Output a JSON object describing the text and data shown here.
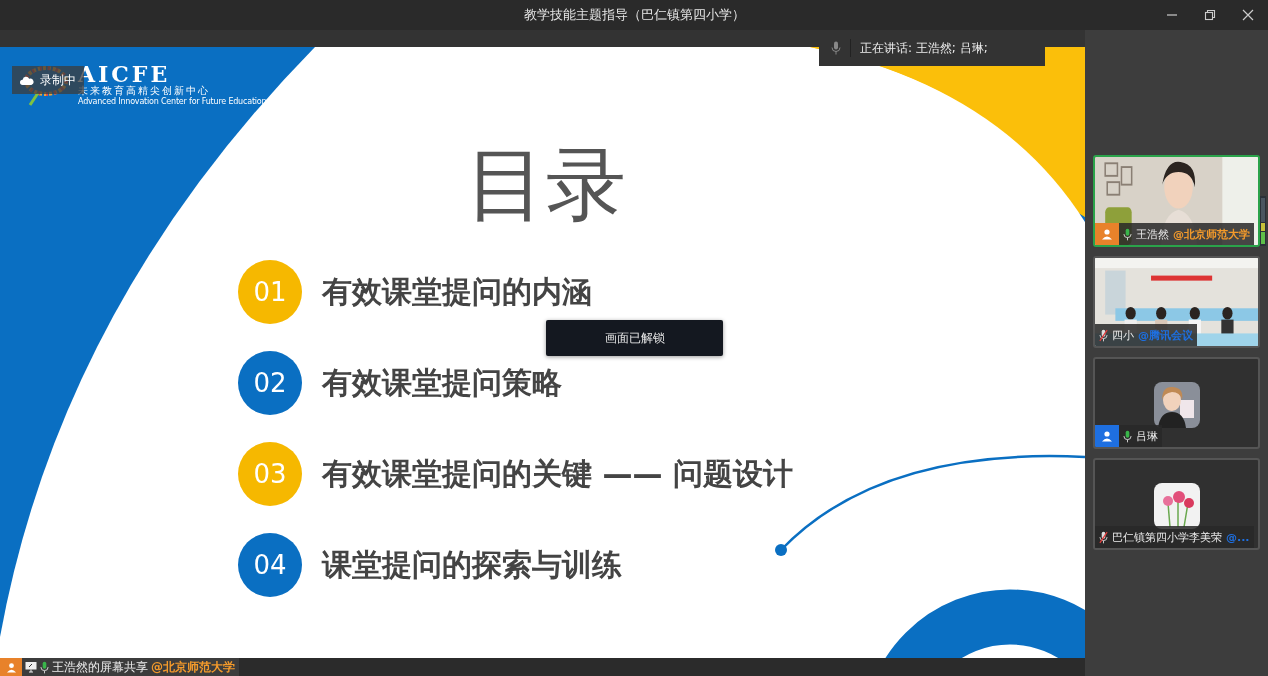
{
  "window": {
    "title": "教学技能主题指导（巴仁镇第四小学）"
  },
  "recording": {
    "label": "录制中"
  },
  "speaking": {
    "label": "正在讲话: 王浩然; 吕琳;"
  },
  "slide": {
    "logo": {
      "name": "AICFE",
      "subtitle": "未来教育高精尖创新中心",
      "english": "Advanced Innovation Center for Future Education"
    },
    "title": "目录",
    "items": [
      {
        "number": "01",
        "text": "有效课堂提问的内涵",
        "color": "#f6b800"
      },
      {
        "number": "02",
        "text": "有效课堂提问策略",
        "color": "#0a6fc2"
      },
      {
        "number": "03",
        "text": "有效课堂提问的关键 —— 问题设计",
        "color": "#f6b800"
      },
      {
        "number": "04",
        "text": "课堂提问的探索与训练",
        "color": "#0a6fc2"
      }
    ]
  },
  "toast": {
    "label": "画面已解锁"
  },
  "participants": [
    {
      "kind": "video",
      "name": "王浩然",
      "org": {
        "text": "@北京师范大学",
        "color": "#f39a2b"
      },
      "host_badge": {
        "color": "#e8822a"
      },
      "muted": false,
      "active": true
    },
    {
      "kind": "video",
      "name": "四小",
      "org": {
        "text": "@腾讯会议",
        "color": "#1e6fe0"
      },
      "muted": true,
      "active": false
    },
    {
      "kind": "avatar",
      "name": "吕琳",
      "host_badge": {
        "color": "#1e6fe0"
      },
      "muted": false,
      "active": false
    },
    {
      "kind": "avatar",
      "name": "巴仁镇第四小学李美荣",
      "org": {
        "text": "@...",
        "color": "#1e6fe0"
      },
      "muted": true,
      "active": false
    }
  ],
  "share_bar": {
    "name": "王浩然的屏幕共享",
    "org": {
      "text": "@北京师范大学",
      "color": "#f39a2b"
    },
    "host_badge": {
      "color": "#e8822a"
    }
  }
}
